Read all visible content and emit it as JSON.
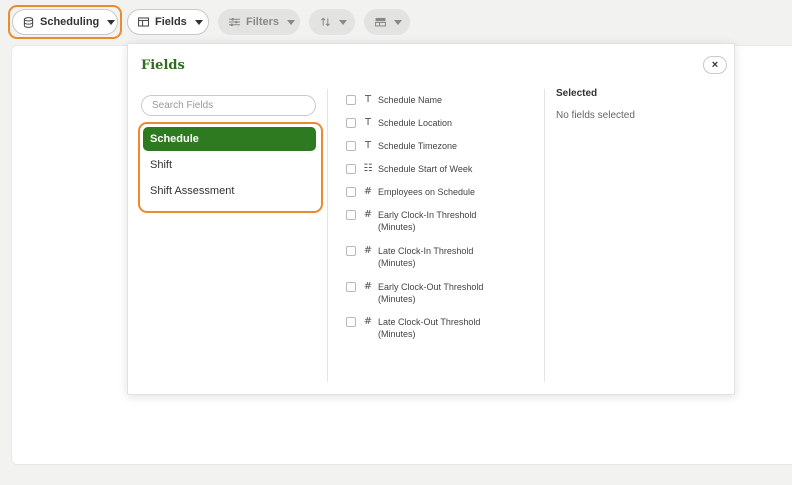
{
  "toolbar": {
    "scheduling_label": "Scheduling",
    "fields_label": "Fields",
    "filters_label": "Filters"
  },
  "panel": {
    "title": "Fields",
    "close_label": "×",
    "search_placeholder": "Search Fields",
    "categories": [
      {
        "label": "Schedule",
        "active": true
      },
      {
        "label": "Shift",
        "active": false
      },
      {
        "label": "Shift Assessment",
        "active": false
      }
    ],
    "fields": [
      {
        "label": "Schedule Name",
        "icon": "text-type-icon"
      },
      {
        "label": "Schedule Location",
        "icon": "text-type-icon"
      },
      {
        "label": "Schedule Timezone",
        "icon": "text-type-icon"
      },
      {
        "label": "Schedule Start of Week",
        "icon": "list-type-icon"
      },
      {
        "label": "Employees on Schedule",
        "icon": "number-type-icon"
      },
      {
        "label": "Early Clock-In Threshold (Minutes)",
        "icon": "number-type-icon"
      },
      {
        "label": "Late Clock-In Threshold (Minutes)",
        "icon": "number-type-icon"
      },
      {
        "label": "Early Clock-Out Threshold (Minutes)",
        "icon": "number-type-icon"
      },
      {
        "label": "Late Clock-Out Threshold (Minutes)",
        "icon": "number-type-icon"
      }
    ],
    "selected_heading": "Selected",
    "selected_empty": "No fields selected"
  },
  "colors": {
    "accent_green": "#2e7a20",
    "highlight_orange": "#ee8a2e"
  }
}
